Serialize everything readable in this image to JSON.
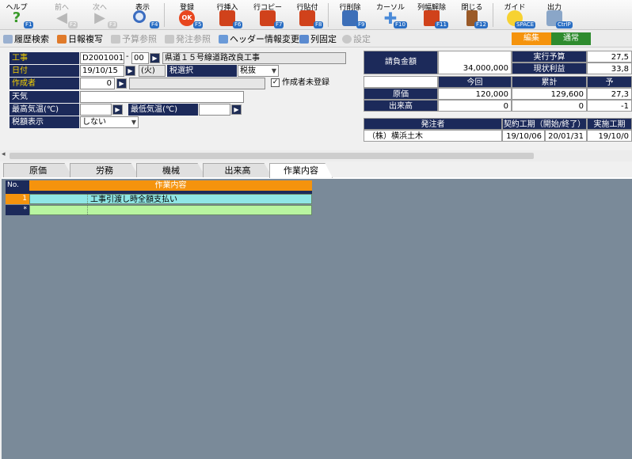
{
  "toolbar": {
    "help": {
      "label": "ヘルプ",
      "key": "F1"
    },
    "prev": {
      "label": "前へ",
      "key": "F2"
    },
    "next": {
      "label": "次へ",
      "key": "F3"
    },
    "view": {
      "label": "表示",
      "key": "F4"
    },
    "register": {
      "label": "登録",
      "key": "F5"
    },
    "insert_row": {
      "label": "行挿入",
      "key": "F6"
    },
    "copy_row": {
      "label": "行コピー",
      "key": "F7"
    },
    "paste_row": {
      "label": "行貼付",
      "key": "F8"
    },
    "delete_row": {
      "label": "行削除",
      "key": "F9"
    },
    "cursor": {
      "label": "カーソル",
      "key": "F10"
    },
    "col_width": {
      "label": "列幅解除",
      "key": "F11"
    },
    "close": {
      "label": "閉じる",
      "key": "F12"
    },
    "guide": {
      "label": "ガイド",
      "key": "SPACE"
    },
    "output": {
      "label": "出力",
      "key": "CtrlP"
    }
  },
  "toolbar2": {
    "history": "履歴検索",
    "copy_daily": "日報複写",
    "budget_ref": "予算参照",
    "order_ref": "発注参照",
    "header_change": "ヘッダー情報変更",
    "col_fix": "列固定",
    "settings": "設定"
  },
  "mode": {
    "edit": "編集",
    "normal": "通常"
  },
  "form": {
    "project_label": "工事",
    "project_code": "D2001001",
    "project_dash": "-",
    "project_sub": "00",
    "project_name": "県道１５号線道路改良工事",
    "date_label": "日付",
    "date_value": "19/10/15",
    "weekday": "(火)",
    "tax_choice_label": "税選択",
    "tax_choice_value": "税抜",
    "author_label": "作成者",
    "author_value": "0",
    "author_unregistered": "作成者未登録",
    "weather_label": "天気",
    "max_temp_label": "最高気温(℃)",
    "min_temp_label": "最低気温(℃)",
    "tax_display_label": "税額表示",
    "tax_display_value": "しない"
  },
  "summary": {
    "contract_label": "請負金額",
    "contract_value": "34,000,000",
    "exec_budget_label": "実行予算",
    "exec_budget_value": "27,5",
    "profit_label": "現状利益",
    "profit_value": "33,8",
    "this_time": "今回",
    "cumulative": "累計",
    "plan": "予",
    "cost_label": "原価",
    "cost_now": "120,000",
    "cost_cum": "129,600",
    "cost_plan": "27,3",
    "progress_label": "出来高",
    "progress_now": "0",
    "progress_cum": "0",
    "progress_plan": "-1",
    "client_label": "発注者",
    "period_label": "契約工期（開始/終了）",
    "actual_label": "実施工期",
    "client_value": "（株）横浜土木",
    "period_start": "19/10/06",
    "period_end": "20/01/31",
    "actual_start": "19/10/0"
  },
  "tabs": [
    "原価",
    "労務",
    "機械",
    "出来高",
    "作業内容"
  ],
  "grid": {
    "no_header": "No.",
    "col_header": "作業内容",
    "rows": [
      {
        "no": "1",
        "text": "工事引渡し時全額支払い"
      }
    ],
    "new_row_marker": "*"
  },
  "colors": {
    "navy": "#1c2a5a",
    "orange": "#f5930d",
    "cyan": "#8fe6e6",
    "green": "#b8f5a0",
    "content_bg": "#7a8a99"
  }
}
